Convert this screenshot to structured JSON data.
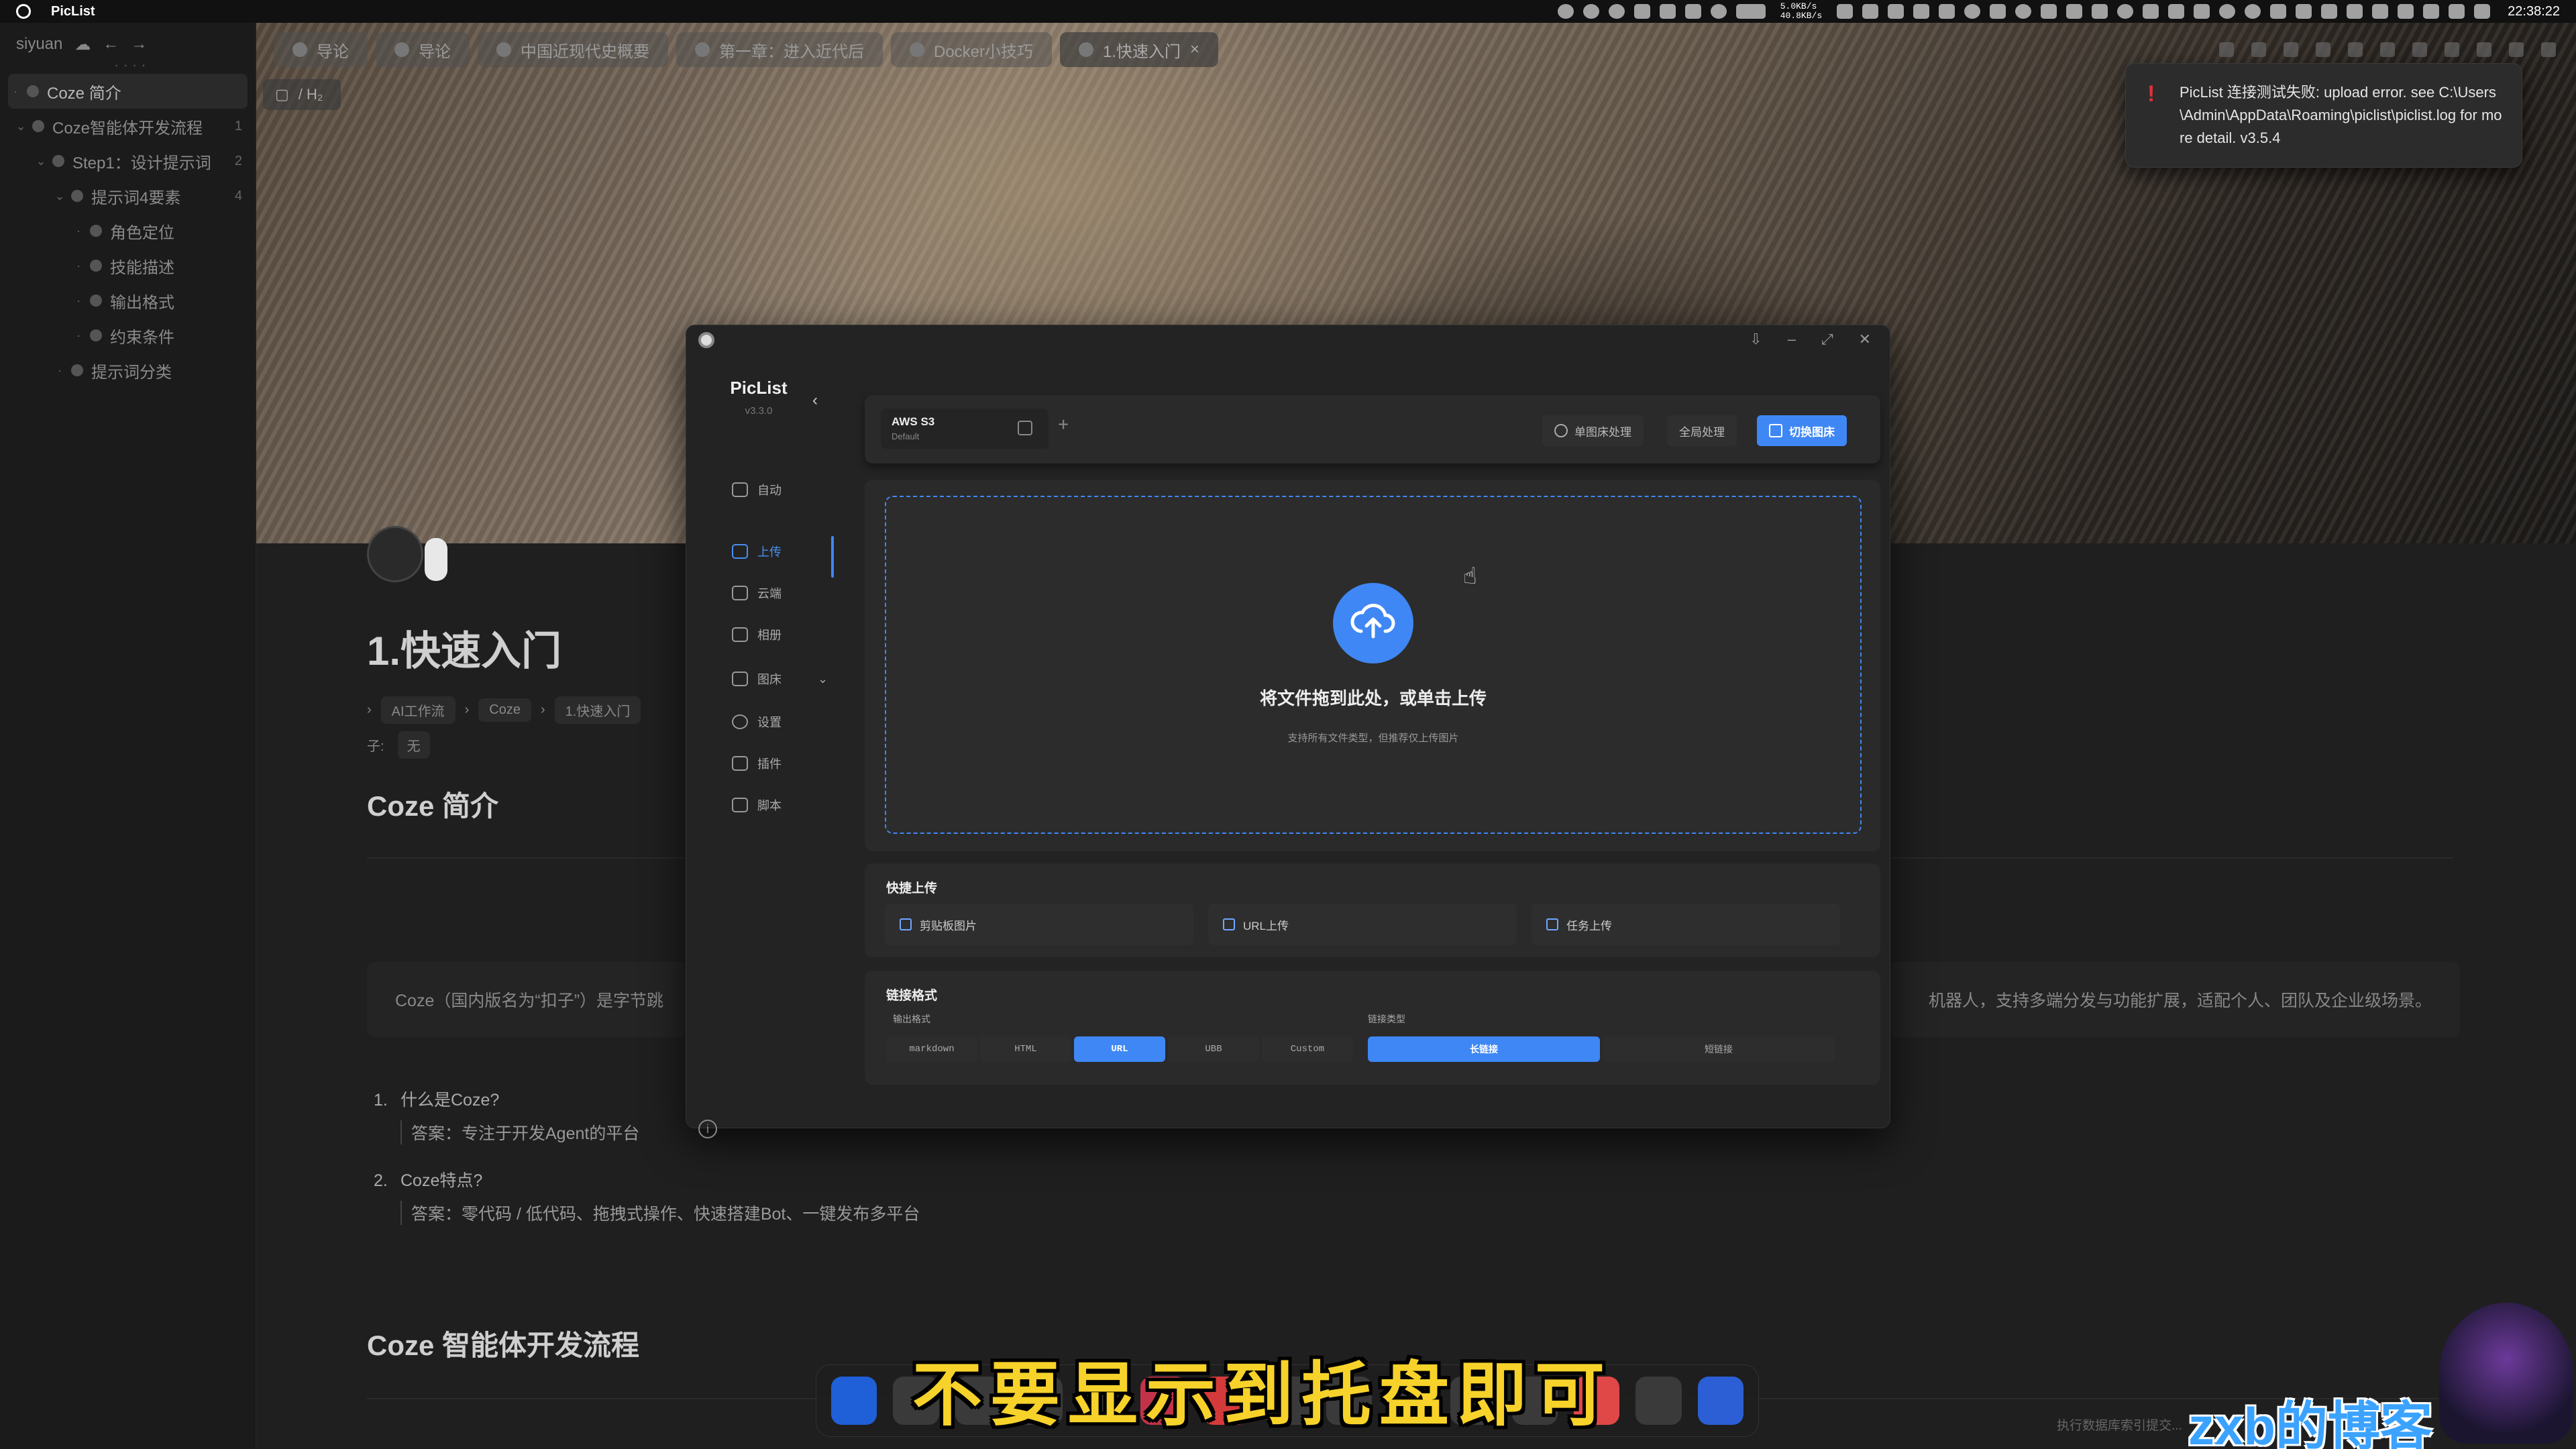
{
  "menubar": {
    "app_name": "PicList",
    "net_up": "5.0KB/s",
    "net_down": "40.8KB/s",
    "time": "22:38:22"
  },
  "sidebar": {
    "workspace": "siyuan",
    "items": [
      {
        "label": "Coze 简介",
        "count": ""
      },
      {
        "label": "Coze智能体开发流程",
        "count": "1"
      },
      {
        "label": "Step1：设计提示词",
        "count": "2"
      },
      {
        "label": "提示词4要素",
        "count": "4"
      },
      {
        "label": "角色定位",
        "count": ""
      },
      {
        "label": "技能描述",
        "count": ""
      },
      {
        "label": "输出格式",
        "count": ""
      },
      {
        "label": "约束条件",
        "count": ""
      },
      {
        "label": "提示词分类",
        "count": ""
      }
    ]
  },
  "tabs": [
    "导论",
    "导论",
    "中国近现代史概要",
    "第一章：进入近代后",
    "Docker小技巧",
    "1.快速入门"
  ],
  "editor": {
    "breadcrumb_mini": "/ H₂",
    "title": "1.快速入门",
    "crumbs": [
      "AI工作流",
      "Coze",
      "1.快速入门"
    ],
    "tag_label": "子:",
    "tag_value": "无",
    "h2_intro": "Coze 简介",
    "quote_left": "Coze（国内版名为“扣子”）是字节跳",
    "quote_right": "机器人，支持多端分发与功能扩展，适配个人、团队及企业级场景。",
    "list": [
      {
        "num": "1.",
        "q": "什么是Coze?",
        "a": "答案：专注于开发Agent的平台"
      },
      {
        "num": "2.",
        "q": "Coze特点?",
        "a": "答案：零代码 / 低代码、拖拽式操作、快速搭建Bot、一键发布多平台"
      }
    ],
    "h2_flow": "Coze 智能体开发流程"
  },
  "piclist": {
    "app_name": "PicList",
    "version": "v3.3.0",
    "nav": [
      "自动",
      "上传",
      "云端",
      "相册",
      "图床",
      "设置",
      "插件",
      "脚本"
    ],
    "picbed_name": "AWS S3",
    "picbed_config": "Default",
    "btn_single": "单图床处理",
    "btn_global": "全局处理",
    "btn_switch": "切换图床",
    "drop_title": "将文件拖到此处，或单击上传",
    "drop_sub": "支持所有文件类型，但推荐仅上传图片",
    "quick_title": "快捷上传",
    "quick": [
      "剪贴板图片",
      "URL上传",
      "任务上传"
    ],
    "link_title": "链接格式",
    "output_label": "输出格式",
    "link_type_label": "链接类型",
    "formats": [
      "markdown",
      "HTML",
      "URL",
      "UBB",
      "Custom"
    ],
    "active_format": "URL",
    "link_types": [
      "长链接",
      "短链接"
    ],
    "active_link_type": "长链接",
    "accent": "#3f87f5"
  },
  "toast": {
    "message": "PicList 连接测试失败: upload error. see C:\\Users\\Admin\\AppData\\Roaming\\piclist\\piclist.log for more detail. v3.5.4"
  },
  "overlay": {
    "subtitle": "不要显示到托盘即可",
    "watermark": "zxb的博客",
    "status": "执行数据库索引提交..."
  }
}
